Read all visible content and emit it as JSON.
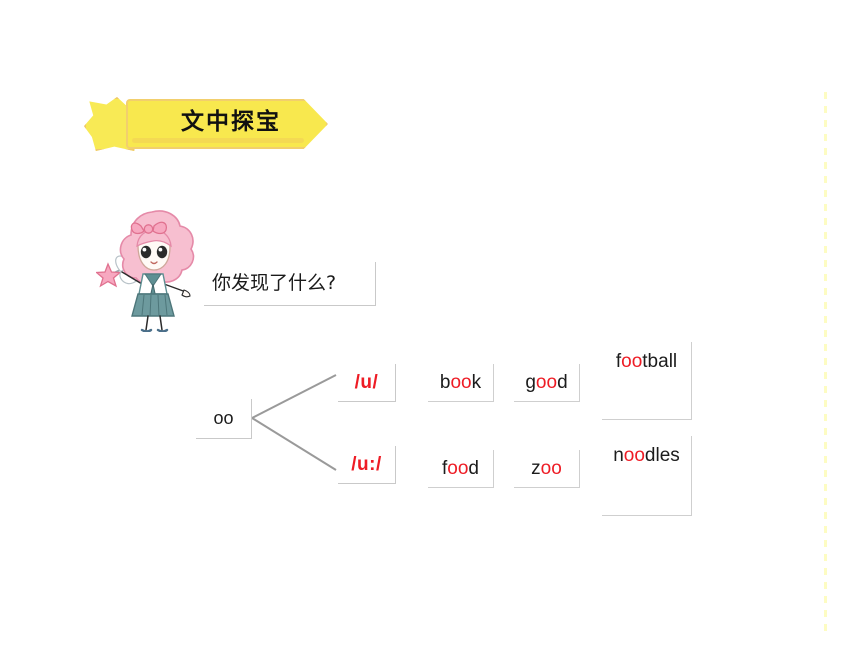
{
  "page": {
    "background": "#ffffff",
    "accent_yellow": "#f8e84e",
    "accent_red": "#ee1c25",
    "rule_gray": "#c9c9c9"
  },
  "banner": {
    "title": "文中探宝",
    "star_icon": "star-burst-icon"
  },
  "character": {
    "name": "fairy-girl-illustration",
    "hair_color": "#f5b6c8",
    "outfit_color": "#5f8f93",
    "wand_star_color": "#f18aa8"
  },
  "question": {
    "text": "你发现了什么?"
  },
  "tree": {
    "root": {
      "label": "oo"
    },
    "branches": [
      {
        "phoneme": "/u/",
        "words": [
          {
            "before": "b",
            "highlight": "oo",
            "after": "k"
          },
          {
            "before": "g",
            "highlight": "oo",
            "after": "d"
          },
          {
            "before": "f",
            "highlight": "oo",
            "after": "tball"
          }
        ]
      },
      {
        "phoneme": "/u:/",
        "words": [
          {
            "before": "f",
            "highlight": "oo",
            "after": "d"
          },
          {
            "before": "z",
            "highlight": "oo",
            "after": ""
          },
          {
            "before": "n",
            "highlight": "oo",
            "after": "dles"
          }
        ]
      }
    ]
  }
}
